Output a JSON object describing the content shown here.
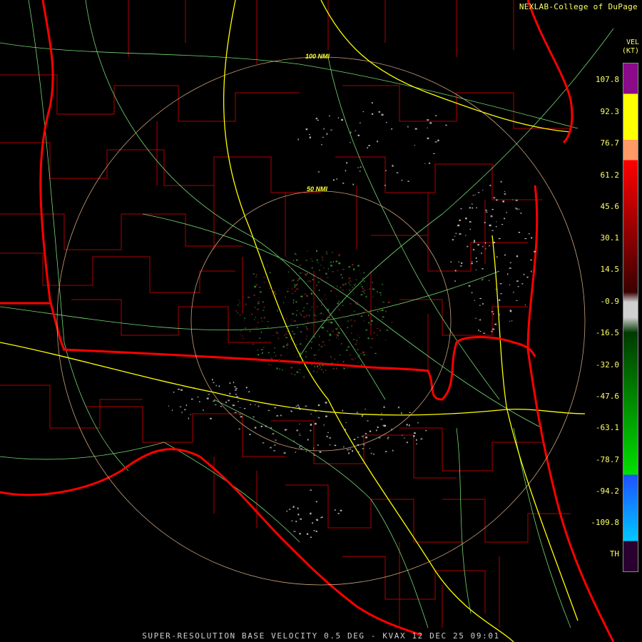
{
  "credit": "NEXLAB-College of DuPage",
  "footer": "SUPER-RESOLUTION BASE VELOCITY 0.5 DEG - KVAX 12 DEC 25 09:01",
  "legend": {
    "title_line1": "VEL",
    "title_line2": "(KT)",
    "labels": [
      "107.8",
      "92.3",
      "76.7",
      "61.2",
      "45.6",
      "30.1",
      "14.5",
      "-0.9",
      "-16.5",
      "-32.0",
      "-47.6",
      "-63.1",
      "-78.7",
      "-94.2",
      "-109.8",
      "TH"
    ],
    "colors": {
      "purple": "#8a0a8a",
      "yellow": "#ffff00",
      "orange": "#ff9966",
      "red": "#ff0000",
      "darkred": "#3a0000",
      "gray": "#d0d0d0",
      "darkgreen": "#003a00",
      "green": "#00e000",
      "blue": "#1e50ff",
      "cyan": "#00c8ff",
      "th": "#2a0030"
    }
  },
  "range_rings": {
    "inner": "50 NMI",
    "outer": "100 NMI"
  },
  "map_colors": {
    "state_border": "#ff0000",
    "county_border": "#b00000",
    "highway": "#ffff00",
    "road": "#88ff88",
    "range_ring": "#ffcc99"
  }
}
